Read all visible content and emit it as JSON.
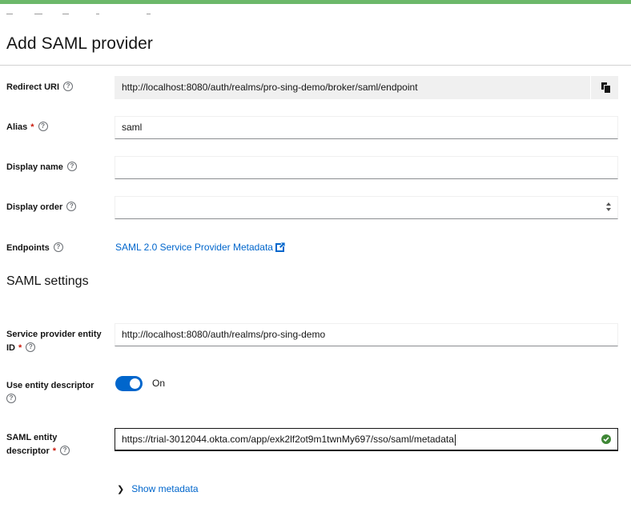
{
  "header": {
    "title": "Add SAML provider"
  },
  "form": {
    "redirect_uri": {
      "label": "Redirect URI",
      "value": "http://localhost:8080/auth/realms/pro-sing-demo/broker/saml/endpoint"
    },
    "alias": {
      "label": "Alias",
      "required": "*",
      "value": "saml"
    },
    "display_name": {
      "label": "Display name",
      "value": ""
    },
    "display_order": {
      "label": "Display order",
      "value": ""
    },
    "endpoints": {
      "label": "Endpoints",
      "link_text": "SAML 2.0 Service Provider Metadata"
    }
  },
  "saml_settings": {
    "title": "SAML settings",
    "sp_entity_id": {
      "label_line1": "Service provider entity",
      "label_line2": "ID",
      "required": "*",
      "value": "http://localhost:8080/auth/realms/pro-sing-demo"
    },
    "use_entity_descriptor": {
      "label": "Use entity descriptor",
      "state_text": "On",
      "on": true
    },
    "saml_entity_descriptor": {
      "label_line1": "SAML entity",
      "label_line2": "descriptor",
      "required": "*",
      "value": "https://trial-3012044.okta.com/app/exk2lf2ot9m1twnMy697/sso/saml/metadata"
    },
    "show_metadata": "Show metadata"
  },
  "colors": {
    "accent": "#0066cc",
    "success": "#3e8635",
    "topbar": "#6cb86a"
  }
}
